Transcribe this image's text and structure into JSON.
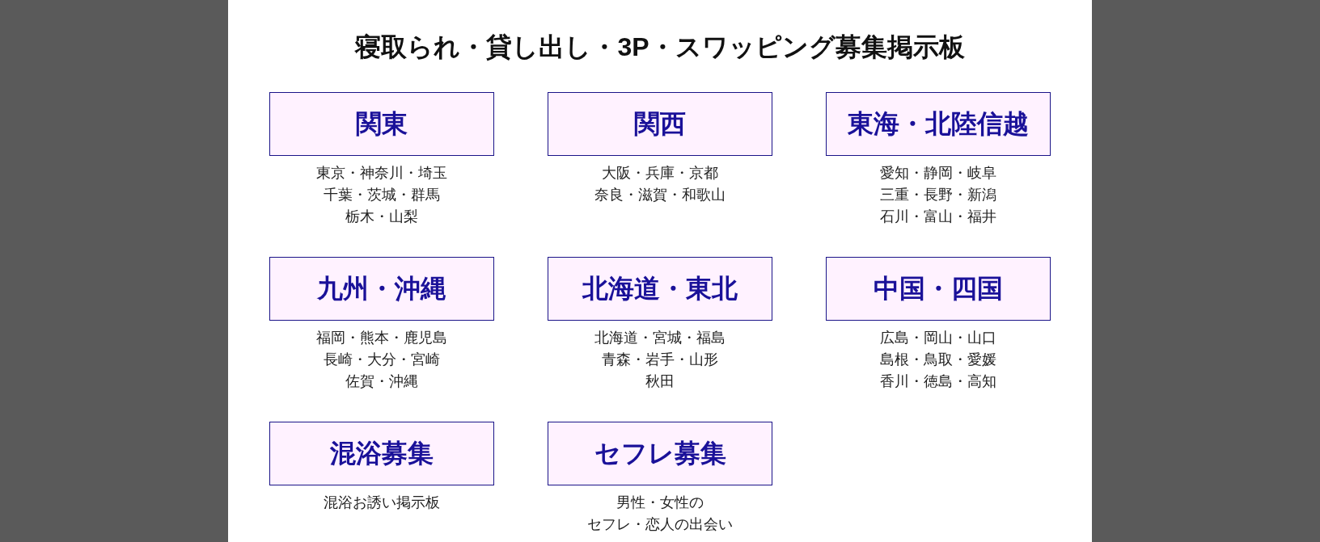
{
  "title": "寝取られ・貸し出し・3P・スワッピング募集掲示板",
  "categories": [
    {
      "label": "関東",
      "lines": [
        "東京・神奈川・埼玉",
        "千葉・茨城・群馬",
        "栃木・山梨"
      ]
    },
    {
      "label": "関西",
      "lines": [
        "大阪・兵庫・京都",
        "奈良・滋賀・和歌山"
      ]
    },
    {
      "label": "東海・北陸信越",
      "lines": [
        "愛知・静岡・岐阜",
        "三重・長野・新潟",
        "石川・富山・福井"
      ]
    },
    {
      "label": "九州・沖縄",
      "lines": [
        "福岡・熊本・鹿児島",
        "長崎・大分・宮崎",
        "佐賀・沖縄"
      ]
    },
    {
      "label": "北海道・東北",
      "lines": [
        "北海道・宮城・福島",
        "青森・岩手・山形",
        "秋田"
      ]
    },
    {
      "label": "中国・四国",
      "lines": [
        "広島・岡山・山口",
        "島根・鳥取・愛媛",
        "香川・徳島・高知"
      ]
    },
    {
      "label": "混浴募集",
      "lines": [
        "混浴お誘い掲示板"
      ]
    },
    {
      "label": "セフレ募集",
      "lines": [
        "男性・女性の",
        "セフレ・恋人の出会い"
      ]
    }
  ]
}
